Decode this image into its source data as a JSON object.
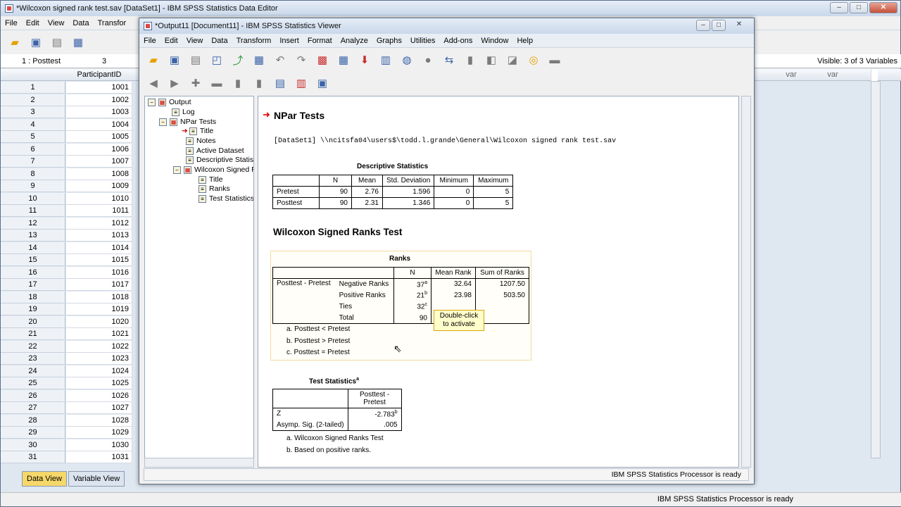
{
  "editor": {
    "title": "*Wilcoxon signed rank test.sav [DataSet1] - IBM SPSS Statistics Data Editor",
    "menu": [
      "File",
      "Edit",
      "View",
      "Data",
      "Transfor"
    ],
    "cell_ref": "1 : Posttest",
    "cell_value": "3",
    "visible": "Visible: 3 of 3 Variables",
    "col_header": "ParticipantID",
    "var_headers": [
      "var",
      "var"
    ],
    "rows": [
      {
        "n": "1",
        "v": "1001"
      },
      {
        "n": "2",
        "v": "1002"
      },
      {
        "n": "3",
        "v": "1003"
      },
      {
        "n": "4",
        "v": "1004"
      },
      {
        "n": "5",
        "v": "1005"
      },
      {
        "n": "6",
        "v": "1006"
      },
      {
        "n": "7",
        "v": "1007"
      },
      {
        "n": "8",
        "v": "1008"
      },
      {
        "n": "9",
        "v": "1009"
      },
      {
        "n": "10",
        "v": "1010"
      },
      {
        "n": "11",
        "v": "1011"
      },
      {
        "n": "12",
        "v": "1012"
      },
      {
        "n": "13",
        "v": "1013"
      },
      {
        "n": "14",
        "v": "1014"
      },
      {
        "n": "15",
        "v": "1015"
      },
      {
        "n": "16",
        "v": "1016"
      },
      {
        "n": "17",
        "v": "1017"
      },
      {
        "n": "18",
        "v": "1018"
      },
      {
        "n": "19",
        "v": "1019"
      },
      {
        "n": "20",
        "v": "1020"
      },
      {
        "n": "21",
        "v": "1021"
      },
      {
        "n": "22",
        "v": "1022"
      },
      {
        "n": "23",
        "v": "1023"
      },
      {
        "n": "24",
        "v": "1024"
      },
      {
        "n": "25",
        "v": "1025"
      },
      {
        "n": "26",
        "v": "1026"
      },
      {
        "n": "27",
        "v": "1027"
      },
      {
        "n": "28",
        "v": "1028"
      },
      {
        "n": "29",
        "v": "1029"
      },
      {
        "n": "30",
        "v": "1030"
      },
      {
        "n": "31",
        "v": "1031"
      }
    ],
    "tab_data": "Data View",
    "tab_variable": "Variable View",
    "status": "IBM SPSS Statistics Processor is ready"
  },
  "viewer": {
    "title": "*Output11 [Document11] - IBM SPSS Statistics Viewer",
    "menu": [
      "File",
      "Edit",
      "View",
      "Data",
      "Transform",
      "Insert",
      "Format",
      "Analyze",
      "Graphs",
      "Utilities",
      "Add-ons",
      "Window",
      "Help"
    ],
    "status": "IBM SPSS Statistics Processor is ready",
    "tree": [
      "Output",
      "Log",
      "NPar Tests",
      "Title",
      "Notes",
      "Active Dataset",
      "Descriptive Statist",
      "Wilcoxon Signed R",
      "Title",
      "Ranks",
      "Test Statistics"
    ],
    "heading_npar": "NPar Tests",
    "dataset_line": "[DataSet1] \\\\ncitsfa04\\users$\\todd.l.grande\\General\\Wilcoxon signed rank test.sav",
    "desc": {
      "caption": "Descriptive Statistics",
      "headers": [
        "N",
        "Mean",
        "Std. Deviation",
        "Minimum",
        "Maximum"
      ],
      "rows": [
        {
          "label": "Pretest",
          "n": "90",
          "mean": "2.76",
          "sd": "1.596",
          "min": "0",
          "max": "5"
        },
        {
          "label": "Posttest",
          "n": "90",
          "mean": "2.31",
          "sd": "1.346",
          "min": "0",
          "max": "5"
        }
      ]
    },
    "heading_wilcoxon": "Wilcoxon Signed Ranks Test",
    "ranks": {
      "caption": "Ranks",
      "headers": [
        "N",
        "Mean Rank",
        "Sum of Ranks"
      ],
      "group": "Posttest - Pretest",
      "rows": [
        {
          "label": "Negative Ranks",
          "n": "37",
          "sup": "a",
          "mean": "32.64",
          "sum": "1207.50"
        },
        {
          "label": "Positive Ranks",
          "n": "21",
          "sup": "b",
          "mean": "23.98",
          "sum": "503.50"
        },
        {
          "label": "Ties",
          "n": "32",
          "sup": "c",
          "mean": "",
          "sum": ""
        },
        {
          "label": "Total",
          "n": "90",
          "sup": "",
          "mean": "",
          "sum": ""
        }
      ],
      "footnotes": [
        "a. Posttest < Pretest",
        "b. Posttest > Pretest",
        "c. Posttest = Pretest"
      ],
      "tooltip": "Double-click to activate"
    },
    "teststats": {
      "caption": "Test Statistics",
      "caption_sup": "a",
      "col_header": "Posttest - Pretest",
      "rows": [
        {
          "label": "Z",
          "value": "-2.783",
          "sup": "b"
        },
        {
          "label": "Asymp. Sig. (2-tailed)",
          "value": ".005",
          "sup": ""
        }
      ],
      "footnotes": [
        "a. Wilcoxon Signed Ranks Test",
        "b. Based on positive ranks."
      ]
    }
  }
}
